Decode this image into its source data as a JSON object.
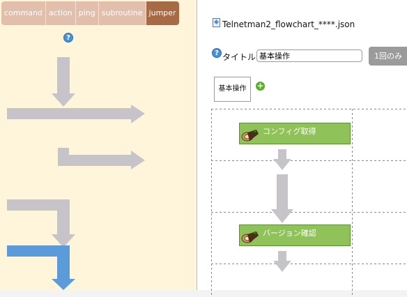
{
  "tabs": [
    {
      "label": "command"
    },
    {
      "label": "action"
    },
    {
      "label": "ping"
    },
    {
      "label": "subroutine"
    },
    {
      "label": "jumper",
      "active": true
    }
  ],
  "help_symbol": "?",
  "file": {
    "name": "Telnetman2_flowchart_****.json",
    "icon": "file-icon"
  },
  "title": {
    "label": "タイトル",
    "value": "基本操作"
  },
  "once_button": {
    "label": "1回のみ"
  },
  "subroutine_box": {
    "label": "基本操作"
  },
  "add_symbol": "+",
  "commands": [
    {
      "label": "コンフィグ取得",
      "icon": "log-cake-icon"
    },
    {
      "label": "バージョン確認",
      "icon": "log-cake-icon"
    }
  ],
  "colors": {
    "tab": "#e2bfad",
    "tab_active": "#a66a45",
    "palette_bg": "#fff5da",
    "arrow_gray": "#c6c4c8",
    "arrow_blue": "#5b9bd9",
    "command_green": "#8fc259"
  }
}
